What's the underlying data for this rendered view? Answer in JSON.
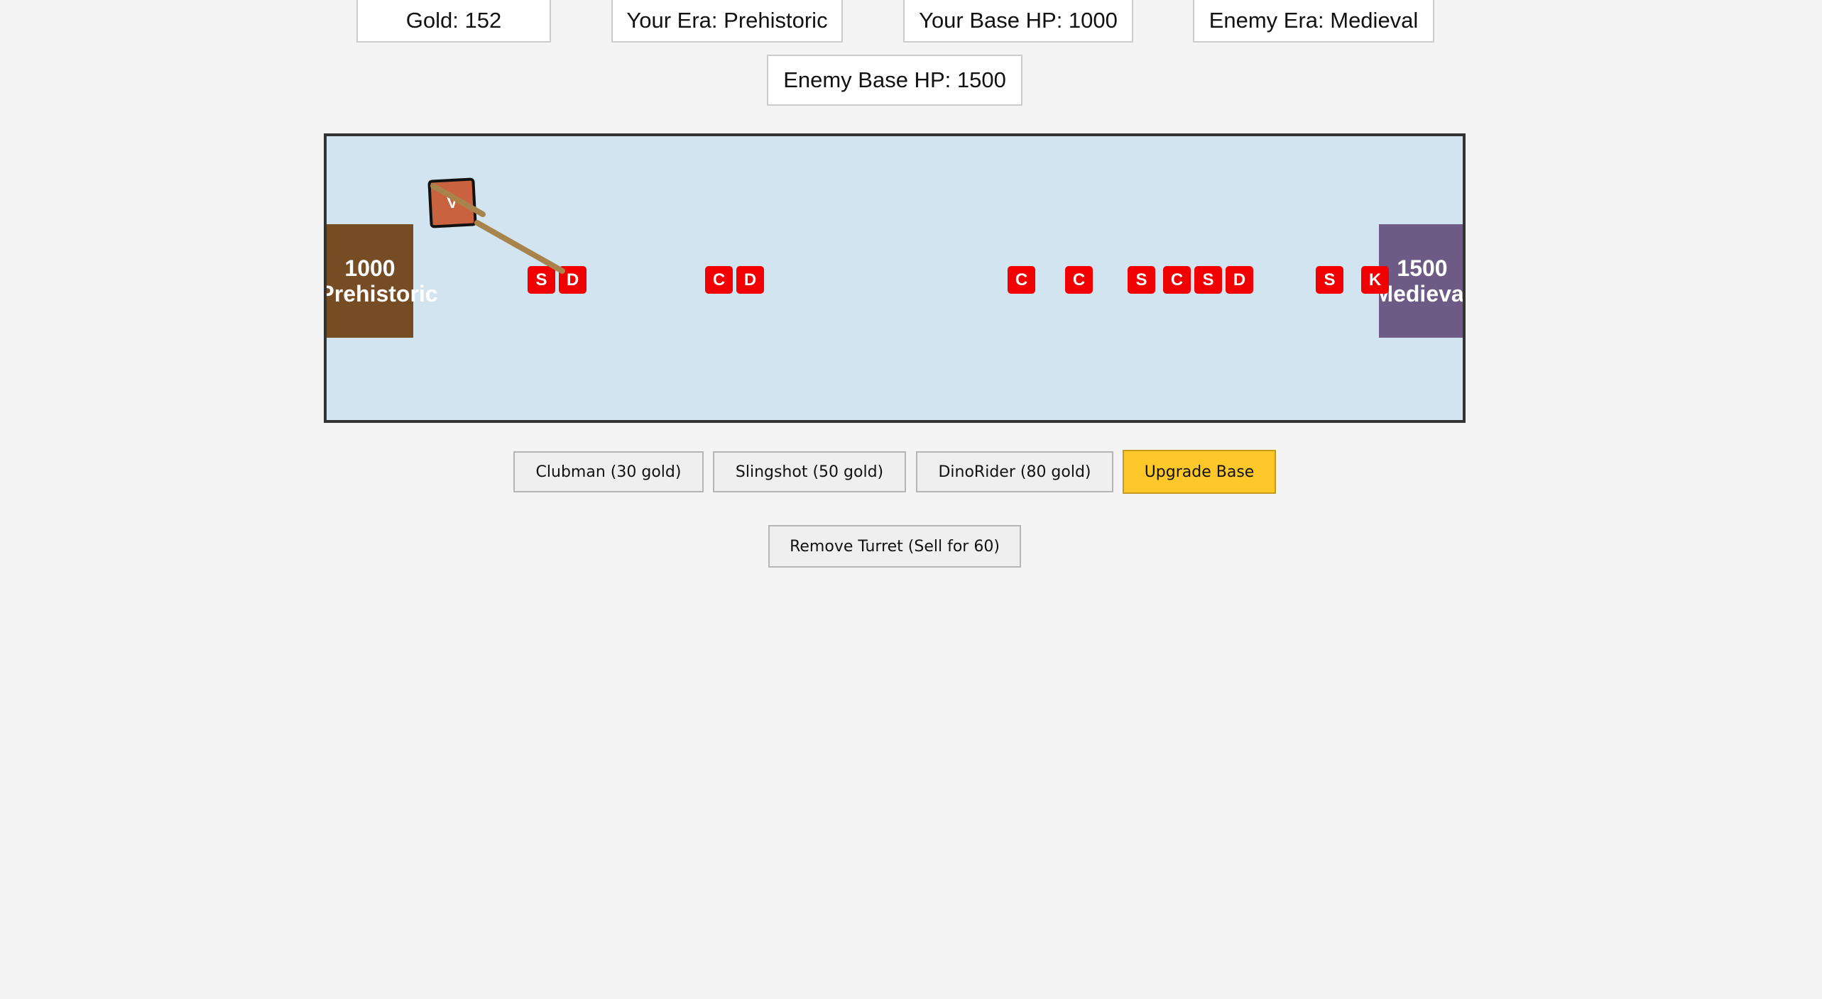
{
  "stats": {
    "gold": "Gold: 152",
    "your_era": "Your Era: Prehistoric",
    "your_base_hp": "Your Base HP: 1000",
    "enemy_era": "Enemy Era: Medieval",
    "enemy_base_hp": "Enemy Base HP: 1500"
  },
  "battlefield": {
    "player_base": {
      "hp": "1000",
      "era": "Prehistoric",
      "color": "#754c24"
    },
    "enemy_base": {
      "hp": "1500",
      "era": "Medieval",
      "color": "#6d5a85"
    },
    "turret": {
      "label": "V",
      "color": "#c8623f"
    },
    "units": [
      "S",
      "D",
      "C",
      "D",
      "C",
      "C",
      "S",
      "C",
      "S",
      "D",
      "S",
      "K"
    ],
    "unit_color": "#f00000",
    "background": "#d1e4ef"
  },
  "controls": {
    "clubman": "Clubman (30 gold)",
    "slingshot": "Slingshot (50 gold)",
    "dinorider": "DinoRider (80 gold)",
    "upgrade": "Upgrade Base",
    "remove_turret": "Remove Turret (Sell for 60)",
    "upgrade_color": "#ffc82a"
  }
}
